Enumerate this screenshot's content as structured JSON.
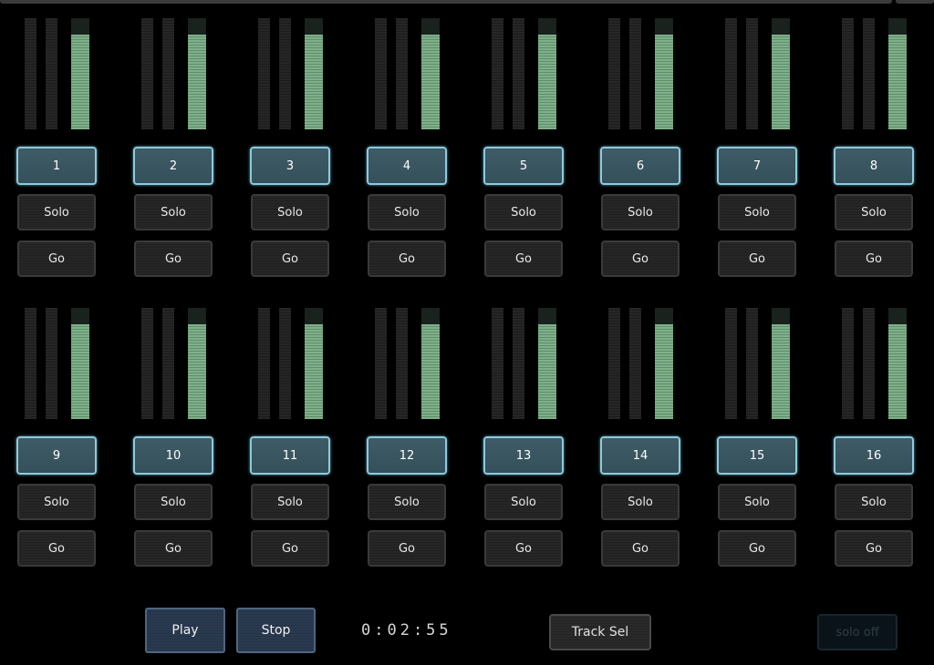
{
  "meter_level_fraction": 0.85,
  "channels": [
    {
      "number": "1",
      "solo": "Solo",
      "go": "Go"
    },
    {
      "number": "2",
      "solo": "Solo",
      "go": "Go"
    },
    {
      "number": "3",
      "solo": "Solo",
      "go": "Go"
    },
    {
      "number": "4",
      "solo": "Solo",
      "go": "Go"
    },
    {
      "number": "5",
      "solo": "Solo",
      "go": "Go"
    },
    {
      "number": "6",
      "solo": "Solo",
      "go": "Go"
    },
    {
      "number": "7",
      "solo": "Solo",
      "go": "Go"
    },
    {
      "number": "8",
      "solo": "Solo",
      "go": "Go"
    },
    {
      "number": "9",
      "solo": "Solo",
      "go": "Go"
    },
    {
      "number": "10",
      "solo": "Solo",
      "go": "Go"
    },
    {
      "number": "11",
      "solo": "Solo",
      "go": "Go"
    },
    {
      "number": "12",
      "solo": "Solo",
      "go": "Go"
    },
    {
      "number": "13",
      "solo": "Solo",
      "go": "Go"
    },
    {
      "number": "14",
      "solo": "Solo",
      "go": "Go"
    },
    {
      "number": "15",
      "solo": "Solo",
      "go": "Go"
    },
    {
      "number": "16",
      "solo": "Solo",
      "go": "Go"
    }
  ],
  "transport": {
    "play_label": "Play",
    "stop_label": "Stop",
    "time": "0:02:55"
  },
  "track_sel_label": "Track Sel",
  "solo_off_label": "solo off",
  "colors": {
    "meter_fill": "#7fb08a",
    "channel_button": "#3f5b66",
    "channel_button_border": "#8ec9dc",
    "transport_button": "#2a3a4e"
  }
}
